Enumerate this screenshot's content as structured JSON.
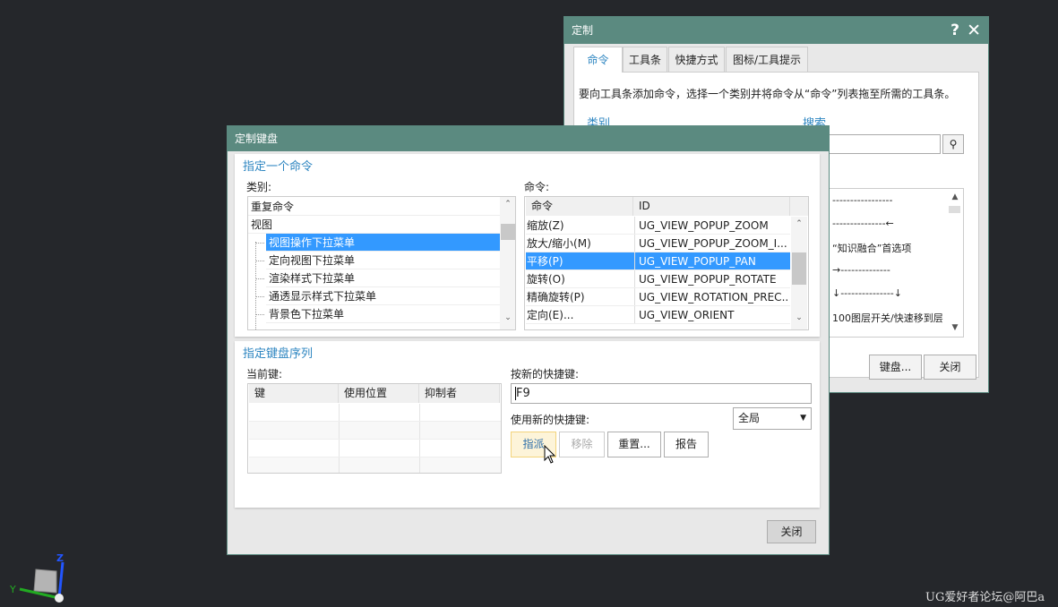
{
  "customize": {
    "title": "定制",
    "help_icon": "question-icon",
    "close_icon": "close-icon",
    "tabs": [
      {
        "label": "命令",
        "selected": true
      },
      {
        "label": "工具条"
      },
      {
        "label": "快捷方式"
      },
      {
        "label": "图标/工具提示"
      }
    ],
    "instruction": "要向工具条添加命令，选择一个类别并将命令从“命令”列表拖至所需的工具条。",
    "category_label": "类别",
    "search_label": "搜索",
    "search_value": "",
    "items": [
      "-----------------",
      "---------------←",
      "“知识融合”首选项",
      "→--------------",
      "↓---------------↓",
      "100图层开关/快速移到层"
    ],
    "keyboard_button": "键盘...",
    "close_button": "关闭"
  },
  "keyboard": {
    "title": "定制键盘",
    "section1": "指定一个命令",
    "category_label": "类别:",
    "command_label": "命令:",
    "categories": [
      {
        "label": "重复命令",
        "indent": 0
      },
      {
        "label": "视图",
        "indent": 0
      },
      {
        "label": "视图操作下拉菜单",
        "indent": 1,
        "selected": true
      },
      {
        "label": "定向视图下拉菜单",
        "indent": 1
      },
      {
        "label": "渲染样式下拉菜单",
        "indent": 1
      },
      {
        "label": "通透显示样式下拉菜单",
        "indent": 1
      },
      {
        "label": "背景色下拉菜单",
        "indent": 1
      }
    ],
    "command_headers": [
      "命令",
      "ID"
    ],
    "commands": [
      [
        "缩放(Z)",
        "UG_VIEW_POPUP_ZOOM"
      ],
      [
        "放大/缩小(M)",
        "UG_VIEW_POPUP_ZOOM_I..."
      ],
      [
        "平移(P)",
        "UG_VIEW_POPUP_PAN"
      ],
      [
        "旋转(O)",
        "UG_VIEW_POPUP_ROTATE"
      ],
      [
        "精确旋转(P)",
        "UG_VIEW_ROTATION_PREC..."
      ],
      [
        "定向(E)...",
        "UG_VIEW_ORIENT"
      ]
    ],
    "selected_command": 2,
    "section2": "指定键盘序列",
    "current_keys_label": "当前键:",
    "key_headers": [
      "键",
      "使用位置",
      "抑制者"
    ],
    "new_key_label": "按新的快捷键:",
    "new_key_value": "F9",
    "use_label": "使用新的快捷键:",
    "scope": "全局",
    "assign": "指派",
    "remove": "移除",
    "reset": "重置...",
    "report": "报告",
    "close": "关闭"
  },
  "triad": {
    "y": "Y",
    "z": "Z"
  },
  "watermark": "UG爱好者论坛@阿巴a",
  "colors": {
    "titlebar": "#5b8a80",
    "selection": "#3399ff",
    "accent": "#2e86c1"
  }
}
